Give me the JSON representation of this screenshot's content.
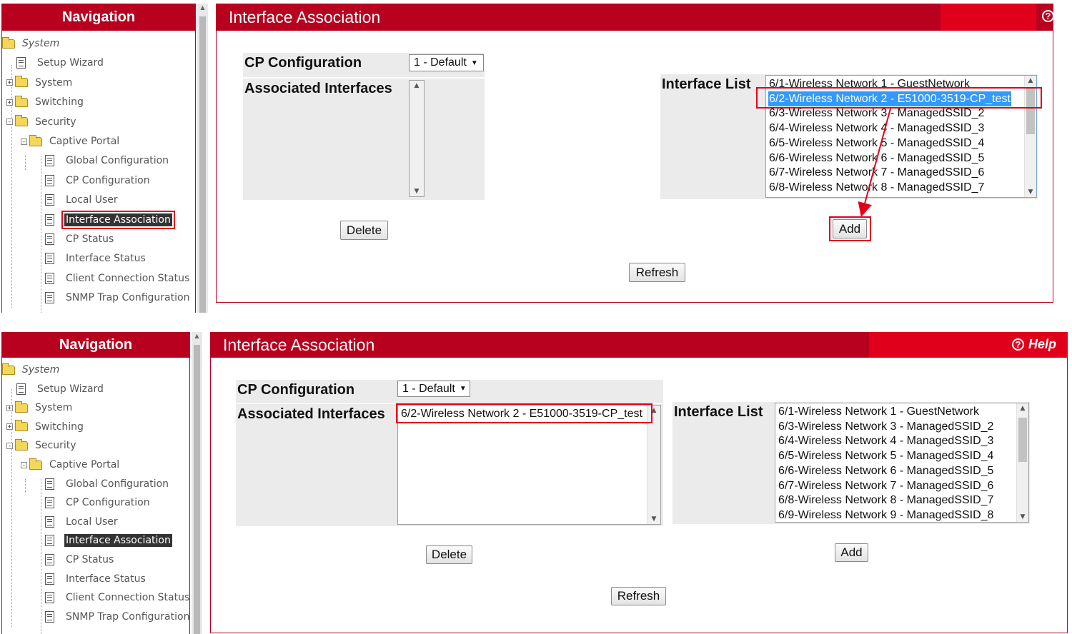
{
  "navigation": {
    "title": "Navigation",
    "items": [
      {
        "label": "System",
        "type": "root",
        "depth": 0
      },
      {
        "label": "Setup Wizard",
        "type": "page",
        "depth": 1
      },
      {
        "label": "System",
        "type": "folder",
        "depth": 1,
        "expander": "+"
      },
      {
        "label": "Switching",
        "type": "folder",
        "depth": 1,
        "expander": "+"
      },
      {
        "label": "Security",
        "type": "folder",
        "depth": 1,
        "expander": "−"
      },
      {
        "label": "Captive Portal",
        "type": "folder",
        "depth": 2,
        "expander": "−"
      },
      {
        "label": "Global Configuration",
        "type": "page",
        "depth": 3
      },
      {
        "label": "CP Configuration",
        "type": "page",
        "depth": 3
      },
      {
        "label": "Local User",
        "type": "page",
        "depth": 3
      },
      {
        "label": "Interface Association",
        "type": "page",
        "depth": 3,
        "selected": true
      },
      {
        "label": "CP Status",
        "type": "page",
        "depth": 3
      },
      {
        "label": "Interface Status",
        "type": "page",
        "depth": 3
      },
      {
        "label": "Client Connection Status",
        "type": "page",
        "depth": 3
      },
      {
        "label": "SNMP Trap Configuration",
        "type": "page",
        "depth": 3
      }
    ]
  },
  "page": {
    "title": "Interface Association",
    "help_label": "Help",
    "cp_config_label": "CP Configuration",
    "cp_config_value": "1 - Default",
    "assoc_label": "Associated Interfaces",
    "iface_list_label": "Interface List",
    "delete_label": "Delete",
    "add_label": "Add",
    "refresh_label": "Refresh"
  },
  "before": {
    "associated": [],
    "interfaces": [
      "6/1-Wireless Network 1 - GuestNetwork",
      "6/2-Wireless Network 2 - E51000-3519-CP_test",
      "6/3-Wireless Network 3 - ManagedSSID_2",
      "6/4-Wireless Network 4 - ManagedSSID_3",
      "6/5-Wireless Network 5 - ManagedSSID_4",
      "6/6-Wireless Network 6 - ManagedSSID_5",
      "6/7-Wireless Network 7 - ManagedSSID_6",
      "6/8-Wireless Network 8 - ManagedSSID_7"
    ],
    "selected_index": 1
  },
  "after": {
    "associated": [
      "6/2-Wireless Network 2 - E51000-3519-CP_test"
    ],
    "interfaces": [
      "6/1-Wireless Network 1 - GuestNetwork",
      "6/3-Wireless Network 3 - ManagedSSID_2",
      "6/4-Wireless Network 4 - ManagedSSID_3",
      "6/5-Wireless Network 5 - ManagedSSID_4",
      "6/6-Wireless Network 6 - ManagedSSID_5",
      "6/7-Wireless Network 7 - ManagedSSID_6",
      "6/8-Wireless Network 8 - ManagedSSID_7",
      "6/9-Wireless Network 9 - ManagedSSID_8"
    ]
  },
  "colors": {
    "header_red": "#b8001f",
    "header_accent": "#e0001b",
    "annotation_red": "#e0001b",
    "selection_blue": "#3399ff"
  }
}
